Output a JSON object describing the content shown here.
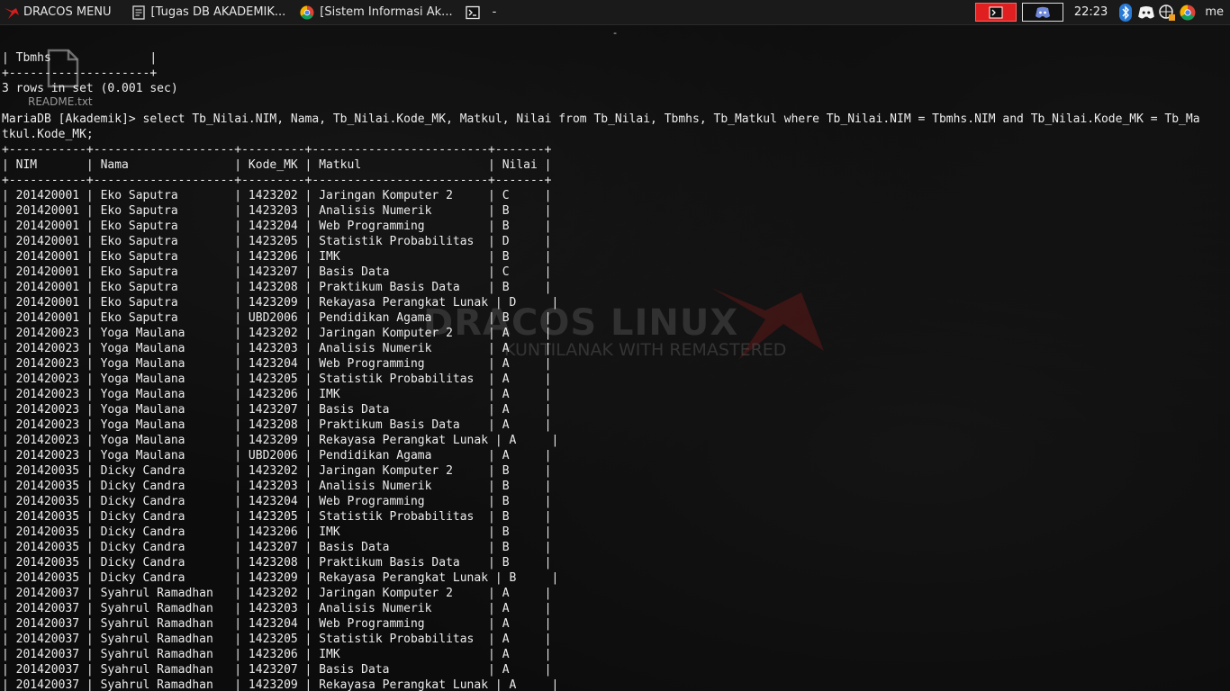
{
  "taskbar": {
    "menu_label": "DRACOS MENU",
    "tasks": [
      {
        "icon": "document-icon",
        "label": "[Tugas  DB AKADEMIK..."
      },
      {
        "icon": "chrome-icon",
        "label": "[Sistem Informasi Ak..."
      },
      {
        "icon": "terminal-icon",
        "label": "-"
      }
    ],
    "clock": "22:23",
    "user": "me"
  },
  "terminal": {
    "title": "-",
    "lines": [
      "| Tbmhs              |",
      "+--------------------+",
      "3 rows in set (0.001 sec)",
      "",
      "MariaDB [Akademik]> select Tb_Nilai.NIM, Nama, Tb_Nilai.Kode_MK, Matkul, Nilai from Tb_Nilai, Tbmhs, Tb_Matkul where Tb_Nilai.NIM = Tbmhs.NIM and Tb_Nilai.Kode_MK = Tb_Ma",
      "tkul.Kode_MK;",
      "+-----------+--------------------+---------+-------------------------+-------+",
      "| NIM       | Nama               | Kode_MK | Matkul                  | Nilai |",
      "+-----------+--------------------+---------+-------------------------+-------+",
      "| 201420001 | Eko Saputra        | 1423202 | Jaringan Komputer 2     | C     |",
      "| 201420001 | Eko Saputra        | 1423203 | Analisis Numerik        | B     |",
      "| 201420001 | Eko Saputra        | 1423204 | Web Programming         | B     |",
      "| 201420001 | Eko Saputra        | 1423205 | Statistik Probabilitas  | D     |",
      "| 201420001 | Eko Saputra        | 1423206 | IMK                     | B     |",
      "| 201420001 | Eko Saputra        | 1423207 | Basis Data              | C     |",
      "| 201420001 | Eko Saputra        | 1423208 | Praktikum Basis Data    | B     |",
      "| 201420001 | Eko Saputra        | 1423209 | Rekayasa Perangkat Lunak | D     |",
      "| 201420001 | Eko Saputra        | UBD2006 | Pendidikan Agama        | B     |",
      "| 201420023 | Yoga Maulana       | 1423202 | Jaringan Komputer 2     | A     |",
      "| 201420023 | Yoga Maulana       | 1423203 | Analisis Numerik        | A     |",
      "| 201420023 | Yoga Maulana       | 1423204 | Web Programming         | A     |",
      "| 201420023 | Yoga Maulana       | 1423205 | Statistik Probabilitas  | A     |",
      "| 201420023 | Yoga Maulana       | 1423206 | IMK                     | A     |",
      "| 201420023 | Yoga Maulana       | 1423207 | Basis Data              | A     |",
      "| 201420023 | Yoga Maulana       | 1423208 | Praktikum Basis Data    | A     |",
      "| 201420023 | Yoga Maulana       | 1423209 | Rekayasa Perangkat Lunak | A     |",
      "| 201420023 | Yoga Maulana       | UBD2006 | Pendidikan Agama        | A     |",
      "| 201420035 | Dicky Candra       | 1423202 | Jaringan Komputer 2     | B     |",
      "| 201420035 | Dicky Candra       | 1423203 | Analisis Numerik        | B     |",
      "| 201420035 | Dicky Candra       | 1423204 | Web Programming         | B     |",
      "| 201420035 | Dicky Candra       | 1423205 | Statistik Probabilitas  | B     |",
      "| 201420035 | Dicky Candra       | 1423206 | IMK                     | B     |",
      "| 201420035 | Dicky Candra       | 1423207 | Basis Data              | B     |",
      "| 201420035 | Dicky Candra       | 1423208 | Praktikum Basis Data    | B     |",
      "| 201420035 | Dicky Candra       | 1423209 | Rekayasa Perangkat Lunak | B     |",
      "| 201420037 | Syahrul Ramadhan   | 1423202 | Jaringan Komputer 2     | A     |",
      "| 201420037 | Syahrul Ramadhan   | 1423203 | Analisis Numerik        | A     |",
      "| 201420037 | Syahrul Ramadhan   | 1423204 | Web Programming         | A     |",
      "| 201420037 | Syahrul Ramadhan   | 1423205 | Statistik Probabilitas  | A     |",
      "| 201420037 | Syahrul Ramadhan   | 1423206 | IMK                     | A     |",
      "| 201420037 | Syahrul Ramadhan   | 1423207 | Basis Data              | A     |",
      "| 201420037 | Syahrul Ramadhan   | 1423209 | Rekayasa Perangkat Lunak | A     |"
    ]
  },
  "desktop": {
    "file_icon": "file-icon",
    "file_label": "README.txt",
    "watermark_title": "DRACOS LINUX",
    "watermark_subtitle": "KUNTILANAK WITH REMASTERED"
  },
  "colors": {
    "background": "#0c0c0c",
    "taskbar": "#1a1a1a",
    "text": "#ececec",
    "accent_red": "#e02020"
  }
}
